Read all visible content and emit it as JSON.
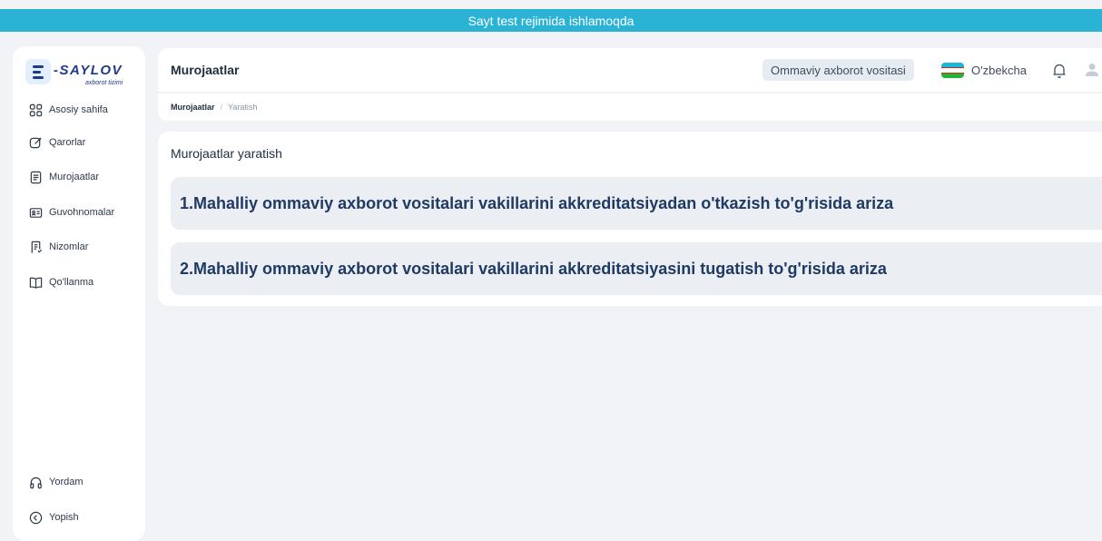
{
  "banner": {
    "text": "Sayt test rejimida ishlamoqda"
  },
  "logo": {
    "name": "-SAYLOV",
    "subtitle": "axborot tizimi"
  },
  "sidebar": {
    "items": [
      {
        "label": "Asosiy sahifa",
        "icon": "grid-icon"
      },
      {
        "label": "Qarorlar",
        "icon": "edit-icon"
      },
      {
        "label": "Murojaatlar",
        "icon": "document-icon"
      },
      {
        "label": "Guvohnomalar",
        "icon": "id-card-icon"
      },
      {
        "label": "Nizomlar",
        "icon": "list-document-icon"
      },
      {
        "label": "Qo'llanma",
        "icon": "book-icon"
      }
    ],
    "footer": [
      {
        "label": "Yordam",
        "icon": "headphones-icon"
      },
      {
        "label": "Yopish",
        "icon": "chevron-left-circle-icon"
      }
    ]
  },
  "header": {
    "title": "Murojaatlar",
    "organization": "Ommaviy axborot vositasi",
    "language": "O'zbekcha"
  },
  "breadcrumb": {
    "parent": "Murojaatlar",
    "separator": "/",
    "current": "Yaratish"
  },
  "main": {
    "title": "Murojaatlar yaratish",
    "applications": [
      "1.Mahalliy ommaviy axborot vositalari vakillarini akkreditatsiyadan o'tkazish to'g'risida ariza",
      "2.Mahalliy ommaviy axborot vositalari vakillarini akkreditatsiyasini tugatish to'g'risida ariza"
    ]
  },
  "colors": {
    "banner": "#2bb3d6",
    "accent": "#1f3a8a",
    "background": "#f1f3f7"
  }
}
